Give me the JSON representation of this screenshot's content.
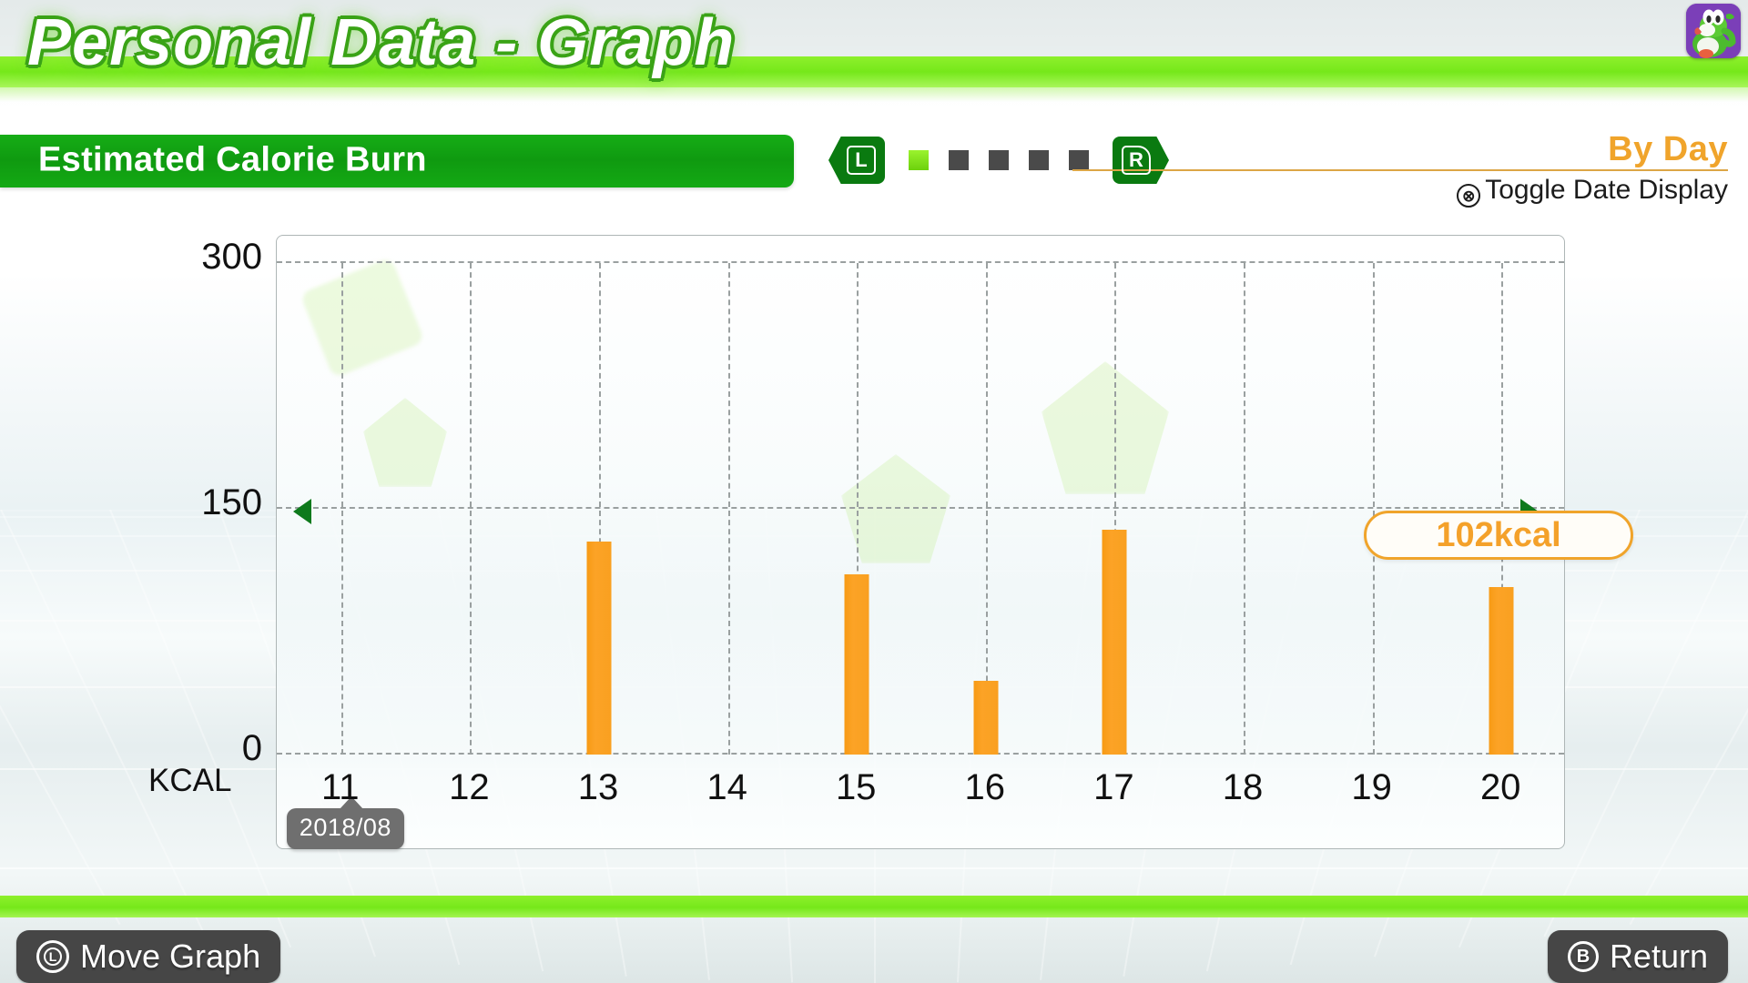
{
  "header": {
    "title": "Personal Data  - Graph",
    "avatar_alt": "yoshi-avatar",
    "avatar_bg": "#7b3fb8"
  },
  "subheader": {
    "category_label": "Estimated Calorie Burn",
    "left_button": "L",
    "right_button": "R",
    "page_dots": 5,
    "active_dot_index": 0,
    "active_dot_color": "#8ee51e",
    "inactive_dot_color": "#4a4a4a",
    "range_label": "By Day",
    "range_color": "#f0a42b",
    "toggle_button": "⊗",
    "toggle_label": "Toggle Date Display"
  },
  "chart_data": {
    "type": "bar",
    "title": "Estimated Calorie Burn",
    "xlabel": "",
    "ylabel": "KCAL",
    "categories": [
      "11",
      "12",
      "13",
      "14",
      "15",
      "16",
      "17",
      "18",
      "19",
      "20"
    ],
    "values": [
      0,
      0,
      130,
      0,
      110,
      45,
      137,
      0,
      0,
      102
    ],
    "ylim": [
      0,
      300
    ],
    "yticks": [
      0,
      150,
      300
    ],
    "ytick_labels": [
      "0",
      "150",
      "300"
    ],
    "unit": "kcal",
    "bar_color": "#fca326",
    "grid": true,
    "grid_color": "#9aa0a0",
    "legend": false,
    "selected_index": 9,
    "selected_value_label": "102kcal",
    "date_tooltip": "2018/08",
    "date_tooltip_index": 0,
    "marker_value": 150,
    "marker_color": "#0e7a1c"
  },
  "footer": {
    "move_glyph": "L",
    "move_label": "Move Graph",
    "return_glyph": "B",
    "return_label": "Return"
  }
}
